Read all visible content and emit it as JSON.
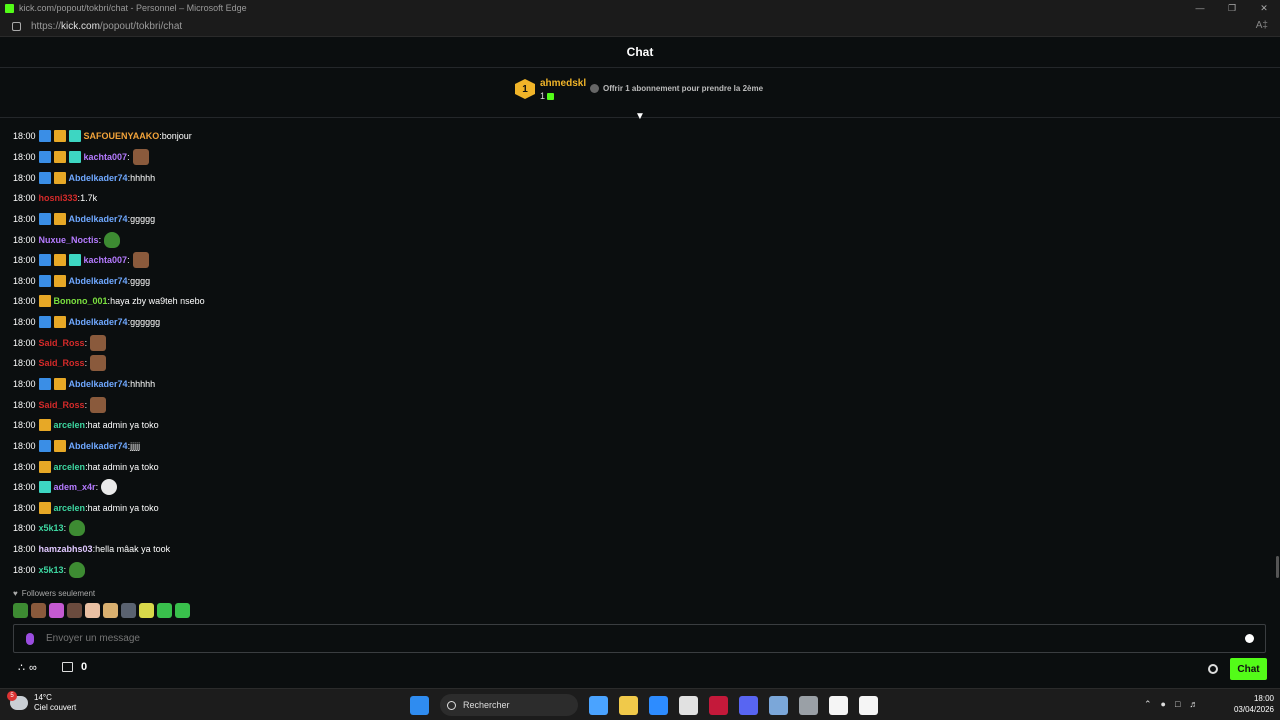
{
  "browser": {
    "window_title": "kick.com/popout/tokbri/chat - Personnel – Microsoft Edge",
    "url_prefix": "https://",
    "url_host": "kick.com",
    "url_path": "/popout/tokbri/chat",
    "reader_icon": "read-aloud-icon"
  },
  "chat": {
    "header": "Chat",
    "pinned": {
      "rank": "1",
      "user": "ahmedskl",
      "count": "1",
      "gift_text": "Offrir 1 abonnement pour prendre la 2ème"
    },
    "messages": [
      {
        "time": "18:00",
        "badges": [
          "sub",
          "vip",
          "og"
        ],
        "user": "SAFOUENYAAKO",
        "color": "#f2a33a",
        "sep": ": ",
        "text": "bonjour",
        "emote": null
      },
      {
        "time": "18:00",
        "badges": [
          "sub",
          "vip",
          "og"
        ],
        "user": "kachta007",
        "color": "#b57bff",
        "sep": ": ",
        "text": "",
        "emote": "face"
      },
      {
        "time": "18:00",
        "badges": [
          "sub",
          "vip"
        ],
        "user": "Abdelkader74",
        "color": "#6fa8ff",
        "sep": ": ",
        "text": "hhhhh",
        "emote": null
      },
      {
        "time": "18:00",
        "badges": [],
        "user": "hosni333",
        "color": "#d42a2a",
        "sep": ": ",
        "text": "1.7k",
        "emote": null
      },
      {
        "time": "18:00",
        "badges": [
          "sub",
          "vip"
        ],
        "user": "Abdelkader74",
        "color": "#6fa8ff",
        "sep": ": ",
        "text": "ggggg",
        "emote": null
      },
      {
        "time": "18:00",
        "badges": [],
        "user": "Nuxue_Noctis",
        "color": "#b57bff",
        "sep": ": ",
        "text": "",
        "emote": "green"
      },
      {
        "time": "18:00",
        "badges": [
          "sub",
          "vip",
          "og"
        ],
        "user": "kachta007",
        "color": "#b57bff",
        "sep": ": ",
        "text": "",
        "emote": "face"
      },
      {
        "time": "18:00",
        "badges": [
          "sub",
          "vip"
        ],
        "user": "Abdelkader74",
        "color": "#6fa8ff",
        "sep": ": ",
        "text": "gggg",
        "emote": null
      },
      {
        "time": "18:00",
        "badges": [
          "vip"
        ],
        "user": "Bonono_001",
        "color": "#7be03f",
        "sep": ": ",
        "text": "haya zby wa9teh nsebo",
        "emote": null
      },
      {
        "time": "18:00",
        "badges": [
          "sub",
          "vip"
        ],
        "user": "Abdelkader74",
        "color": "#6fa8ff",
        "sep": ": ",
        "text": "gggggg",
        "emote": null
      },
      {
        "time": "18:00",
        "badges": [],
        "user": "Said_Ross",
        "color": "#d42a2a",
        "sep": ": ",
        "text": "",
        "emote": "face"
      },
      {
        "time": "18:00",
        "badges": [],
        "user": "Said_Ross",
        "color": "#d42a2a",
        "sep": ": ",
        "text": "",
        "emote": "face"
      },
      {
        "time": "18:00",
        "badges": [
          "sub",
          "vip"
        ],
        "user": "Abdelkader74",
        "color": "#6fa8ff",
        "sep": ": ",
        "text": "hhhhh",
        "emote": null
      },
      {
        "time": "18:00",
        "badges": [],
        "user": "Said_Ross",
        "color": "#d42a2a",
        "sep": ": ",
        "text": "",
        "emote": "face"
      },
      {
        "time": "18:00",
        "badges": [
          "vip"
        ],
        "user": "arcelen",
        "color": "#3dd6a0",
        "sep": ": ",
        "text": "hat admin ya toko",
        "emote": null
      },
      {
        "time": "18:00",
        "badges": [
          "sub",
          "vip"
        ],
        "user": "Abdelkader74",
        "color": "#6fa8ff",
        "sep": ": ",
        "text": "jjjjj",
        "emote": null
      },
      {
        "time": "18:00",
        "badges": [
          "vip"
        ],
        "user": "arcelen",
        "color": "#3dd6a0",
        "sep": ": ",
        "text": "hat admin ya toko",
        "emote": null
      },
      {
        "time": "18:00",
        "badges": [
          "og"
        ],
        "user": "adem_x4r",
        "color": "#b57bff",
        "sep": ": ",
        "text": "",
        "emote": "duck"
      },
      {
        "time": "18:00",
        "badges": [
          "vip"
        ],
        "user": "arcelen",
        "color": "#3dd6a0",
        "sep": ": ",
        "text": "hat admin ya toko",
        "emote": null
      },
      {
        "time": "18:00",
        "badges": [],
        "user": "x5k13",
        "color": "#3dd6a0",
        "sep": ": ",
        "text": "",
        "emote": "green"
      },
      {
        "time": "18:00",
        "badges": [],
        "user": "hamzabhs03",
        "color": "#e0c8ff",
        "sep": ": ",
        "text": "hella mâak ya took",
        "emote": null
      },
      {
        "time": "18:00",
        "badges": [],
        "user": "x5k13",
        "color": "#3dd6a0",
        "sep": ": ",
        "text": "",
        "emote": "green"
      }
    ],
    "followers_only": "Followers seulement",
    "emote_bar": [
      "#3d8b32",
      "#8a5a3c",
      "#c45ad1",
      "#6b4b3e",
      "#e9c0a3",
      "#d9b070",
      "#5a6270",
      "#d8d84a",
      "#39c04c",
      "#39c04c"
    ],
    "input_placeholder": "Envoyer un message",
    "infinity_label": "∞",
    "points": "0",
    "chat_button": "Chat"
  },
  "taskbar": {
    "temperature": "14°C",
    "weather": "Ciel couvert",
    "weather_badge": "5",
    "search_label": "Rechercher",
    "time": "18:00",
    "date": "03/04/2026",
    "apps": [
      "#4aa3ff",
      "#f0c94a",
      "#2d8cff",
      "#e1e1e1",
      "#c4193a",
      "#5865f2",
      "#7ba7d9",
      "#9aa0a6",
      "#f5f5f5",
      "#f5f5f5"
    ]
  }
}
